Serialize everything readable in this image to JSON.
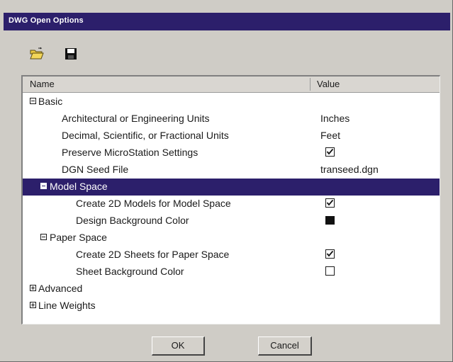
{
  "window": {
    "title": "DWG Open Options"
  },
  "toolbar": {
    "open_icon": "folder-open-icon",
    "save_icon": "floppy-disk-icon"
  },
  "tree": {
    "columns": {
      "name": "Name",
      "value": "Value"
    },
    "rows": [
      {
        "label": "Basic",
        "expander": "minus"
      },
      {
        "label": "Architectural or Engineering Units",
        "value": "Inches"
      },
      {
        "label": "Decimal, Scientific, or Fractional Units",
        "value": "Feet"
      },
      {
        "label": "Preserve MicroStation Settings",
        "checked": true
      },
      {
        "label": "DGN Seed File",
        "value": "transeed.dgn"
      },
      {
        "label": "Model Space",
        "expander": "minus",
        "selected": true
      },
      {
        "label": "Create 2D Models for Model Space",
        "checked": true
      },
      {
        "label": "Design Background Color",
        "color": "#111111"
      },
      {
        "label": "Paper Space",
        "expander": "minus"
      },
      {
        "label": "Create 2D Sheets for Paper Space",
        "checked": true
      },
      {
        "label": "Sheet Background Color",
        "checked": false
      },
      {
        "label": "Advanced",
        "expander": "plus"
      },
      {
        "label": "Line Weights",
        "expander": "plus"
      }
    ]
  },
  "buttons": {
    "ok": "OK",
    "cancel": "Cancel"
  },
  "colors": {
    "selection": "#2c1f6b",
    "title_bar": "#2c1f6b",
    "dialog_bg": "#cfccc6"
  }
}
